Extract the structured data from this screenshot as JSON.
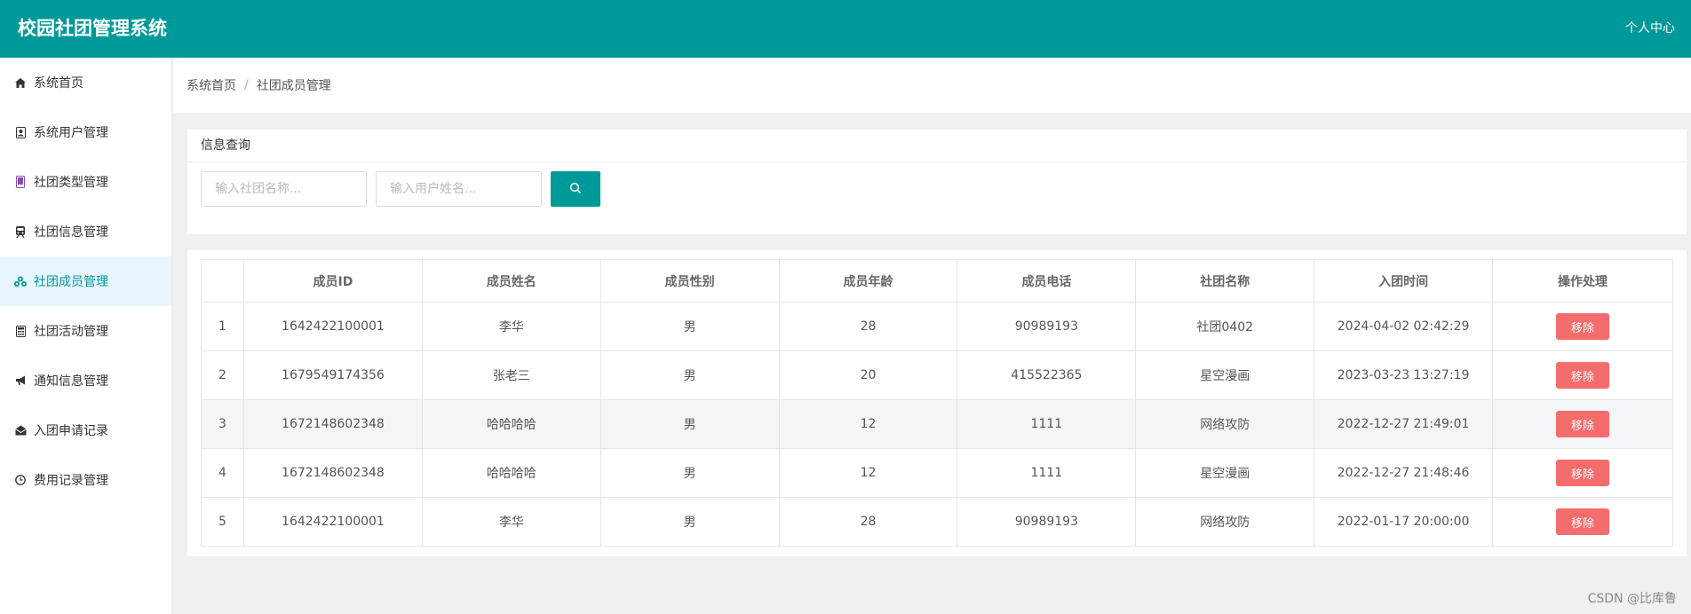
{
  "header": {
    "title": "校园社团管理系统",
    "user_center": "个人中心"
  },
  "colors": {
    "primary": "#009999",
    "danger": "#f56c6c",
    "active_bg": "#e8f4ff"
  },
  "sidebar": {
    "items": [
      {
        "label": "系统首页",
        "icon": "home-icon"
      },
      {
        "label": "系统用户管理",
        "icon": "user-card-icon"
      },
      {
        "label": "社团类型管理",
        "icon": "tablet-icon"
      },
      {
        "label": "社团信息管理",
        "icon": "train-icon"
      },
      {
        "label": "社团成员管理",
        "icon": "cubes-icon",
        "active": true
      },
      {
        "label": "社团活动管理",
        "icon": "calculator-icon"
      },
      {
        "label": "通知信息管理",
        "icon": "megaphone-icon"
      },
      {
        "label": "入团申请记录",
        "icon": "envelope-open-icon"
      },
      {
        "label": "费用记录管理",
        "icon": "clock-icon"
      }
    ]
  },
  "breadcrumb": {
    "home": "系统首页",
    "separator": "/",
    "current": "社团成员管理"
  },
  "query": {
    "title": "信息查询",
    "club_placeholder": "输入社团名称...",
    "user_placeholder": "输入用户姓名...",
    "search_icon": "search-icon"
  },
  "table": {
    "headers": [
      "",
      "成员ID",
      "成员姓名",
      "成员性别",
      "成员年龄",
      "成员电话",
      "社团名称",
      "入团时间",
      "操作处理"
    ],
    "rows": [
      {
        "no": "1",
        "id": "1642422100001",
        "name": "李华",
        "gender": "男",
        "age": "28",
        "phone": "90989193",
        "club": "社团0402",
        "joined": "2024-04-02 02:42:29",
        "action": "移除"
      },
      {
        "no": "2",
        "id": "1679549174356",
        "name": "张老三",
        "gender": "男",
        "age": "20",
        "phone": "415522365",
        "club": "星空漫画",
        "joined": "2023-03-23 13:27:19",
        "action": "移除"
      },
      {
        "no": "3",
        "id": "1672148602348",
        "name": "哈哈哈哈",
        "gender": "男",
        "age": "12",
        "phone": "1111",
        "club": "网络攻防",
        "joined": "2022-12-27 21:49:01",
        "action": "移除"
      },
      {
        "no": "4",
        "id": "1672148602348",
        "name": "哈哈哈哈",
        "gender": "男",
        "age": "12",
        "phone": "1111",
        "club": "星空漫画",
        "joined": "2022-12-27 21:48:46",
        "action": "移除"
      },
      {
        "no": "5",
        "id": "1642422100001",
        "name": "李华",
        "gender": "男",
        "age": "28",
        "phone": "90989193",
        "club": "网络攻防",
        "joined": "2022-01-17 20:00:00",
        "action": "移除"
      }
    ]
  },
  "watermark": "CSDN @比库鲁"
}
